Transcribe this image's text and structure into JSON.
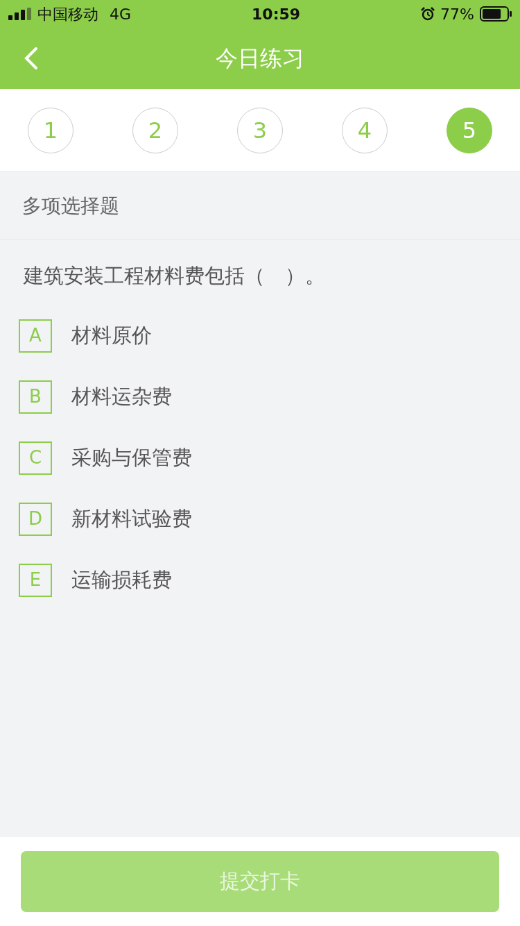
{
  "status_bar": {
    "carrier": "中国移动",
    "network": "4G",
    "time": "10:59",
    "battery": "77%"
  },
  "header": {
    "title": "今日练习"
  },
  "steps": [
    {
      "label": "1",
      "selected": false
    },
    {
      "label": "2",
      "selected": false
    },
    {
      "label": "3",
      "selected": false
    },
    {
      "label": "4",
      "selected": false
    },
    {
      "label": "5",
      "selected": true
    }
  ],
  "section": {
    "title": "多项选择题"
  },
  "question": {
    "text": "建筑安装工程材料费包括（　）。"
  },
  "options": [
    {
      "letter": "A",
      "text": "材料原价",
      "selected": false
    },
    {
      "letter": "B",
      "text": "材料运杂费",
      "selected": false
    },
    {
      "letter": "C",
      "text": "采购与保管费",
      "selected": false
    },
    {
      "letter": "D",
      "text": "新材料试验费",
      "selected": false
    },
    {
      "letter": "E",
      "text": "运输损耗费",
      "selected": false
    }
  ],
  "submit": {
    "label": "提交打卡",
    "disabled": true
  }
}
